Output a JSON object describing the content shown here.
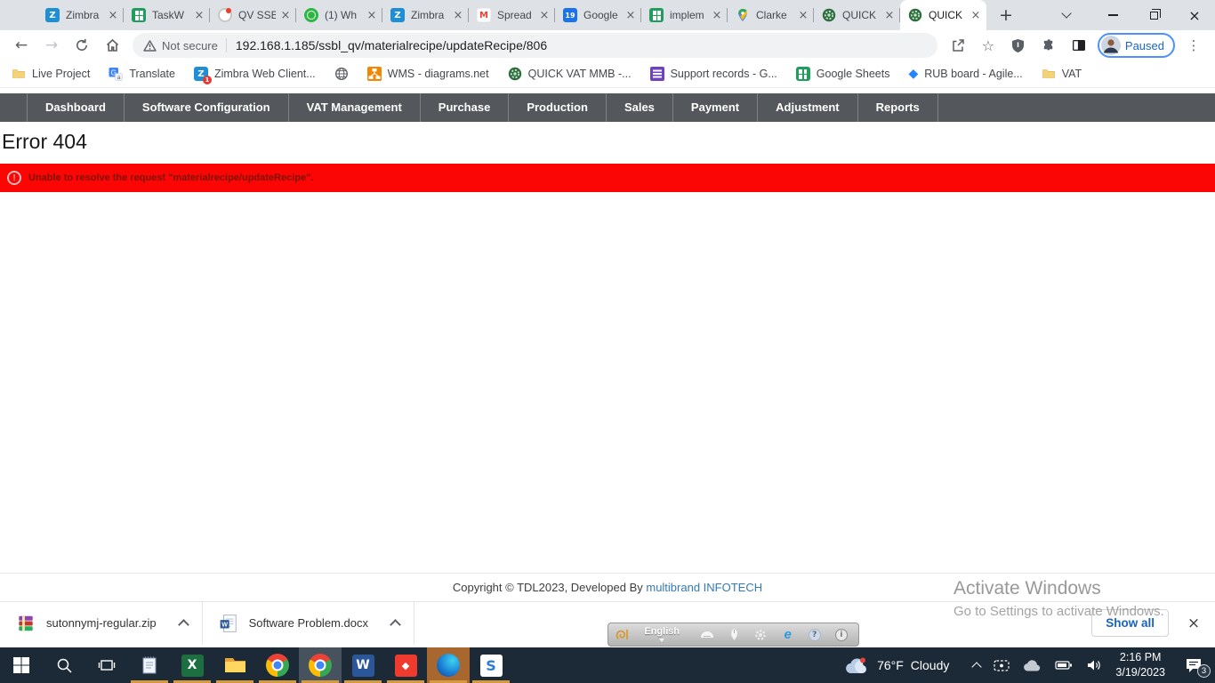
{
  "glyphs": {
    "back_arrow": "←",
    "forward_arrow": "→",
    "star": "☆",
    "kebab": "⋮",
    "close": "×",
    "plus": "+",
    "diamond": "◆",
    "zimbra_z": "Z",
    "gmail_m": "M",
    "calendar_19": "19",
    "translate_g": "G",
    "excel_x": "X",
    "word_w": "W",
    "s_letter": "S",
    "question": "?",
    "info": "i",
    "exclamation": "!",
    "badge_1": "1"
  },
  "tabs": {
    "items": [
      {
        "label": "Zimbra",
        "icon": "zimbra",
        "active": false
      },
      {
        "label": "TaskW",
        "icon": "sheets",
        "active": false
      },
      {
        "label": "QV SSB",
        "icon": "qv",
        "active": false
      },
      {
        "label": "(1) Wh",
        "icon": "whatsapp",
        "active": false
      },
      {
        "label": "Zimbra",
        "icon": "zimbra",
        "active": false
      },
      {
        "label": "Spread",
        "icon": "gmail",
        "active": false
      },
      {
        "label": "Google",
        "icon": "calendar",
        "active": false
      },
      {
        "label": "implem",
        "icon": "sheets",
        "active": false
      },
      {
        "label": "Clarke",
        "icon": "maps",
        "active": false
      },
      {
        "label": "QUICK",
        "icon": "quick",
        "active": false
      },
      {
        "label": "QUICK",
        "icon": "quick",
        "active": true
      }
    ]
  },
  "toolbar": {
    "security_label": "Not secure",
    "url": "192.168.1.185/ssbl_qv/materialrecipe/updateRecipe/806",
    "profile_status": "Paused"
  },
  "bookmarks": [
    {
      "label": "Live Project",
      "icon": "folder"
    },
    {
      "label": "Translate",
      "icon": "translate"
    },
    {
      "label": "Zimbra Web Client...",
      "icon": "zimbra-badge"
    },
    {
      "label": "",
      "icon": "globe"
    },
    {
      "label": "WMS - diagrams.net",
      "icon": "diagrams"
    },
    {
      "label": "QUICK VAT MMB -...",
      "icon": "quick"
    },
    {
      "label": "Support records - G...",
      "icon": "support"
    },
    {
      "label": "Google Sheets",
      "icon": "sheets"
    },
    {
      "label": "RUB board - Agile...",
      "icon": "rub"
    },
    {
      "label": "VAT",
      "icon": "folder"
    }
  ],
  "nav_menu": {
    "items": [
      "Dashboard",
      "Software Configuration",
      "VAT Management",
      "Purchase",
      "Production",
      "Sales",
      "Payment",
      "Adjustment",
      "Reports"
    ]
  },
  "content": {
    "heading": "Error 404",
    "error_message": "Unable to resolve the request \"materialrecipe/updateRecipe\".",
    "footer_prefix": "Copyright © TDL2023, Developed By ",
    "footer_link": "multibrand INFOTECH"
  },
  "watermark": {
    "line1": "Activate Windows",
    "line2": "Go to Settings to activate Windows."
  },
  "downloads": {
    "items": [
      {
        "name": "sutonnymj-regular.zip",
        "icon": "winrar"
      },
      {
        "name": "Software Problem.docx",
        "icon": "word-doc"
      }
    ],
    "show_all": "Show all"
  },
  "language_bar": {
    "language": "English"
  },
  "taskbar": {
    "apps": [
      {
        "id": "start",
        "open": false
      },
      {
        "id": "search",
        "open": false
      },
      {
        "id": "task-view",
        "open": false
      },
      {
        "id": "notepad",
        "open": true
      },
      {
        "id": "excel",
        "open": true
      },
      {
        "id": "file-explorer",
        "open": true
      },
      {
        "id": "chrome",
        "open": true
      },
      {
        "id": "chrome",
        "open": true,
        "active": true
      },
      {
        "id": "word",
        "open": true
      },
      {
        "id": "anydesk",
        "open": true
      },
      {
        "id": "edge",
        "open": true,
        "highlight": true
      },
      {
        "id": "s-app",
        "open": true
      }
    ],
    "weather": {
      "temp": "76°F",
      "condition": "Cloudy"
    },
    "clock": {
      "time": "2:16 PM",
      "date": "3/19/2023"
    },
    "notification_count": "3"
  }
}
